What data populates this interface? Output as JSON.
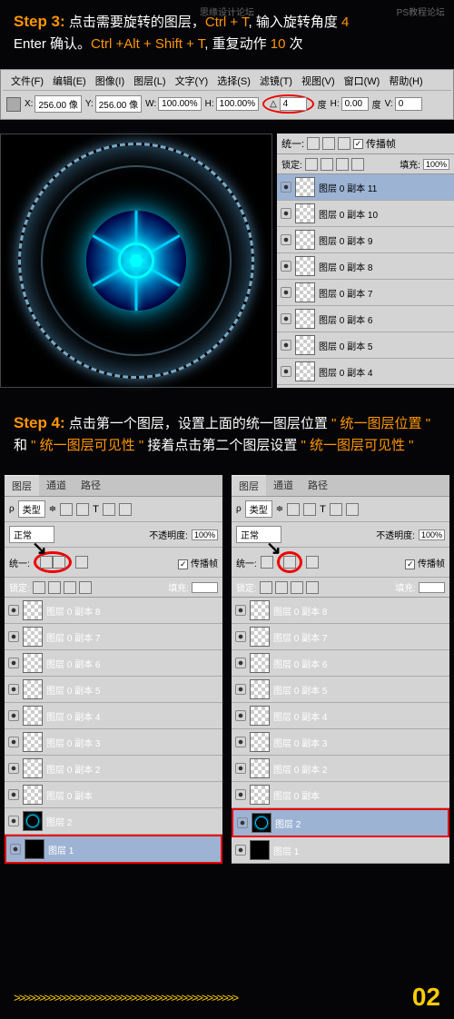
{
  "watermark": {
    "right": "PS教程论坛",
    "center": "思缘设计论坛"
  },
  "step3": {
    "label": "Step 3:",
    "t1": " 点击需要旋转的图层，",
    "k1": "Ctrl + T",
    "t2": ", 输入旋转角度 ",
    "k2": "4",
    "t3": "Enter 确认。",
    "k3": "Ctrl +Alt + Shift + T",
    "t4": ", 重复动作 ",
    "k4": "10",
    "t5": " 次"
  },
  "menu": [
    "文件(F)",
    "编辑(E)",
    "图像(I)",
    "图层(L)",
    "文字(Y)",
    "选择(S)",
    "滤镜(T)",
    "视图(V)",
    "窗口(W)",
    "帮助(H)"
  ],
  "options": {
    "x": "256.00 像",
    "y": "256.00 像",
    "w": "100.00%",
    "h": "100.00%",
    "angle": "4",
    "deg": "度",
    "hlabel": "H:",
    "hval": "0.00",
    "vlabel": "V:",
    "vval": "0"
  },
  "panel3": {
    "header": "统一:",
    "prop": "传播帧",
    "lock": "锁定:",
    "fill": "填充:",
    "pct": "100%",
    "layers": [
      "图层 0 副本 11",
      "图层 0 副本 10",
      "图层 0 副本 9",
      "图层 0 副本 8",
      "图层 0 副本 7",
      "图层 0 副本 6",
      "图层 0 副本 5",
      "图层 0 副本 4"
    ]
  },
  "step4": {
    "label": "Step 4:",
    "t1": " 点击第一个图层，设置上面的统一图层位置 ",
    "q1": "\" 统一图层位置 \"",
    "t2": " 和 ",
    "q2": "\" 统一图层可见性 \"",
    "t3": " 接着点击第二个图层设置 ",
    "q3": "\" 统一图层可见性 \""
  },
  "panelTabs": {
    "layers": "图层",
    "channels": "通道",
    "paths": "路径"
  },
  "panelCommon": {
    "type": "类型",
    "mode": "正常",
    "opacity": "不透明度:",
    "unify": "统一:",
    "prop": "传播帧",
    "lock": "锁定:",
    "fill": "填充:",
    "pct": "100%"
  },
  "leftLayers": [
    "图层 0 副本 8",
    "图层 0 副本 7",
    "图层 0 副本 6",
    "图层 0 副本 5",
    "图层 0 副本 4",
    "图层 0 副本 3",
    "图层 0 副本 2",
    "图层 0 副本"
  ],
  "rightLayers": [
    "图层 0 副本 8",
    "图层 0 副本 7",
    "图层 0 副本 6",
    "图层 0 副本 5",
    "图层 0 副本 4",
    "图层 0 副本 3",
    "图层 0 副本 2",
    "图层 0 副本"
  ],
  "specialLayers": {
    "layer2": "图层 2",
    "layer1": "图层 1"
  },
  "footer": {
    "chevrons": ">>>>>>>>>>>>>>>>>>>>>>>>>>>>>>>>>>>>>>>>>>>>",
    "page": "02"
  }
}
